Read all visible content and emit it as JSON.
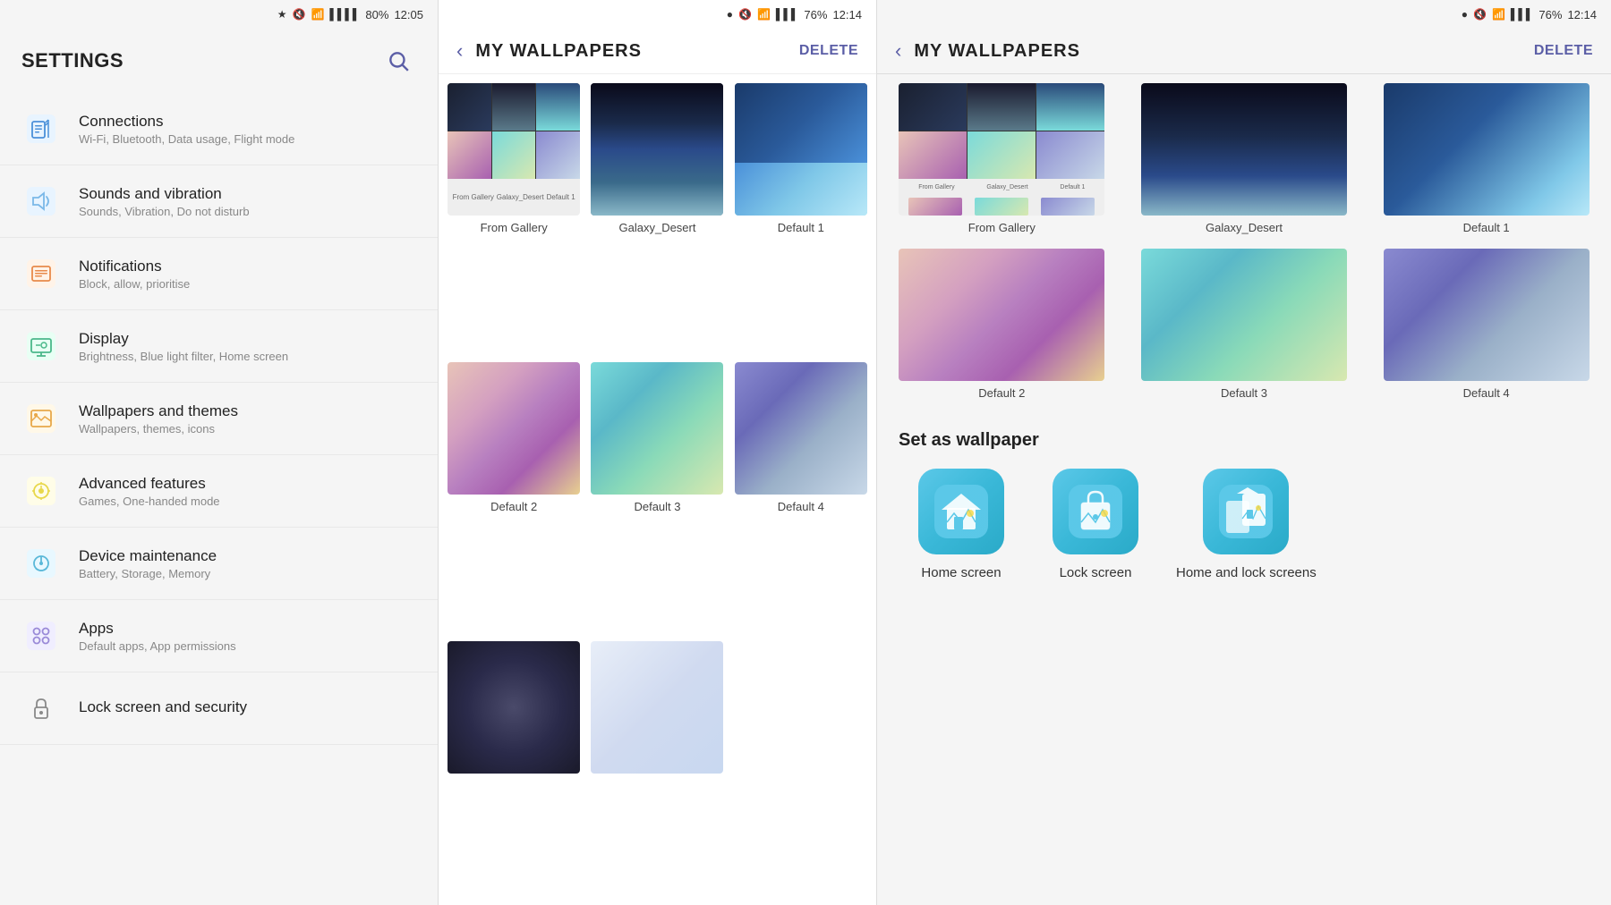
{
  "panel1": {
    "statusBar": {
      "bluetooth": "B",
      "mute": "🔇",
      "wifi": "WiFi",
      "signal": "▌▌▌▌",
      "battery": "80%",
      "time": "12:05"
    },
    "title": "SETTINGS",
    "searchLabel": "search",
    "items": [
      {
        "id": "connections",
        "title": "Connections",
        "subtitle": "Wi-Fi, Bluetooth, Data usage, Flight mode",
        "iconColor": "#4a90d9"
      },
      {
        "id": "sounds",
        "title": "Sounds and vibration",
        "subtitle": "Sounds, Vibration, Do not disturb",
        "iconColor": "#7ab8e8"
      },
      {
        "id": "notifications",
        "title": "Notifications",
        "subtitle": "Block, allow, prioritise",
        "iconColor": "#e88a4a"
      },
      {
        "id": "display",
        "title": "Display",
        "subtitle": "Brightness, Blue light filter, Home screen",
        "iconColor": "#4ab88a"
      },
      {
        "id": "wallpapers",
        "title": "Wallpapers and themes",
        "subtitle": "Wallpapers, themes, icons",
        "iconColor": "#e8a84a"
      },
      {
        "id": "advanced",
        "title": "Advanced features",
        "subtitle": "Games, One-handed mode",
        "iconColor": "#e8d84a"
      },
      {
        "id": "device",
        "title": "Device maintenance",
        "subtitle": "Battery, Storage, Memory",
        "iconColor": "#5ab8d8"
      },
      {
        "id": "apps",
        "title": "Apps",
        "subtitle": "Default apps, App permissions",
        "iconColor": "#9a8ad8"
      },
      {
        "id": "lockscreen",
        "title": "Lock screen and security",
        "subtitle": "",
        "iconColor": "#8a8a8a"
      }
    ]
  },
  "panel2": {
    "statusBar": {
      "bluetooth": "B",
      "mute": "🔇",
      "wifi": "WiFi",
      "signal": "▌▌▌▌",
      "battery": "76%",
      "time": "12:14"
    },
    "title": "MY WALLPAPERS",
    "backLabel": "back",
    "deleteLabel": "DELETE",
    "wallpapers": [
      {
        "id": "from-gallery",
        "label": "From Gallery",
        "type": "mini-grid"
      },
      {
        "id": "galaxy-desert",
        "label": "Galaxy_Desert",
        "type": "galaxy-desert"
      },
      {
        "id": "default1",
        "label": "Default 1",
        "type": "default1"
      },
      {
        "id": "default2",
        "label": "Default 2",
        "type": "default2"
      },
      {
        "id": "default3",
        "label": "Default 3",
        "type": "default3"
      },
      {
        "id": "default4",
        "label": "Default 4",
        "type": "default4"
      },
      {
        "id": "dark-spiral",
        "label": "",
        "type": "dark-spiral"
      },
      {
        "id": "white-feather",
        "label": "",
        "type": "white-feather"
      }
    ]
  },
  "panel3": {
    "statusBar": {
      "battery": "76%",
      "time": "12:14"
    },
    "title": "MY WALLPAPERS",
    "backLabel": "back",
    "deleteLabel": "DELETE",
    "wallpapers": [
      {
        "id": "from-gallery",
        "label": "From Gallery",
        "type": "mini-grid"
      },
      {
        "id": "galaxy-desert",
        "label": "Galaxy_Desert",
        "type": "galaxy-desert"
      },
      {
        "id": "default1",
        "label": "Default 1",
        "type": "default1"
      },
      {
        "id": "default2",
        "label": "Default 2",
        "type": "default2"
      },
      {
        "id": "default3",
        "label": "Default 3",
        "type": "default3"
      },
      {
        "id": "default4",
        "label": "Default 4",
        "type": "default4"
      }
    ],
    "setAsWallpaper": {
      "title": "Set as wallpaper",
      "options": [
        {
          "id": "home-screen",
          "label": "Home screen"
        },
        {
          "id": "lock-screen",
          "label": "Lock screen"
        },
        {
          "id": "home-and-lock",
          "label": "Home and lock screens"
        }
      ]
    }
  }
}
